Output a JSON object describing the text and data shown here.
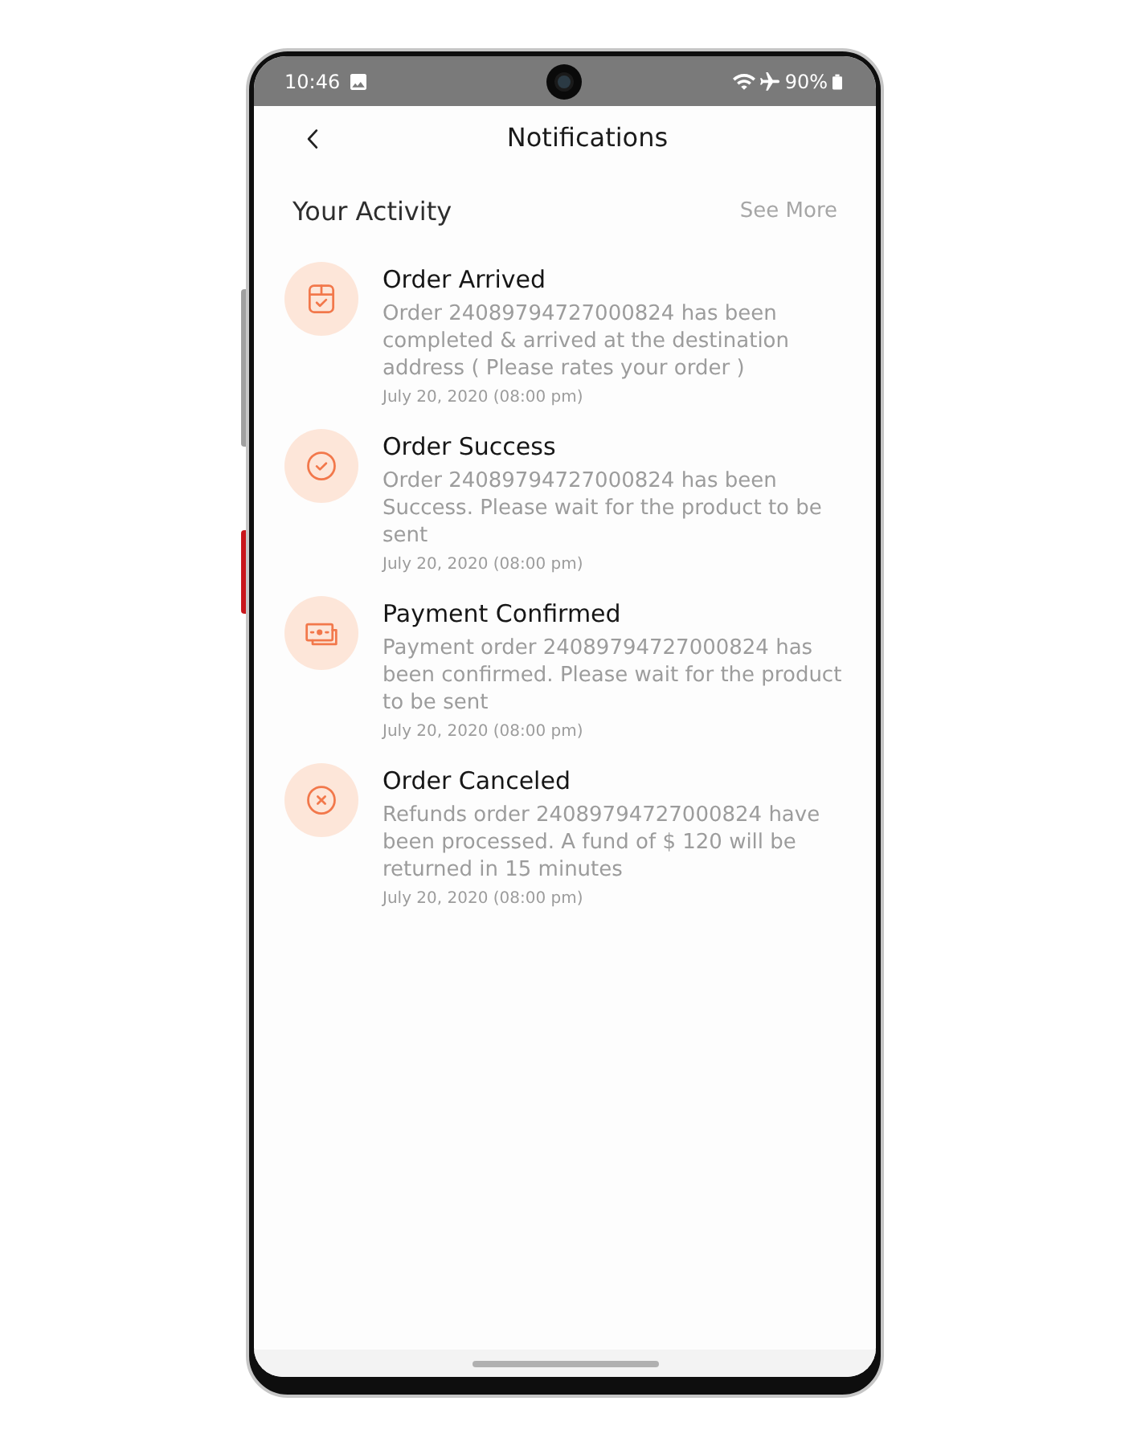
{
  "status_bar": {
    "time": "10:46",
    "battery": "90%"
  },
  "header": {
    "title": "Notifications"
  },
  "activity": {
    "title": "Your Activity",
    "link": "See More"
  },
  "notifications": [
    {
      "kind": "arrived",
      "title": "Order Arrived",
      "body": "Order 24089794727000824 has been completed & arrived at the destination address ( Please rates your order )",
      "date": "July 20, 2020 (08:00 pm)"
    },
    {
      "kind": "success",
      "title": "Order Success",
      "body": "Order 24089794727000824 has been Success. Please wait for the product to be sent",
      "date": "July 20, 2020 (08:00 pm)"
    },
    {
      "kind": "payment",
      "title": "Payment Confirmed",
      "body": "Payment order 24089794727000824 has been confirmed. Please wait for the product to be sent",
      "date": "July 20, 2020 (08:00 pm)"
    },
    {
      "kind": "canceled",
      "title": "Order Canceled",
      "body": "Refunds order 24089794727000824 have been processed. A fund of $ 120 will be returned in 15 minutes",
      "date": "July 20, 2020 (08:00 pm)"
    }
  ]
}
